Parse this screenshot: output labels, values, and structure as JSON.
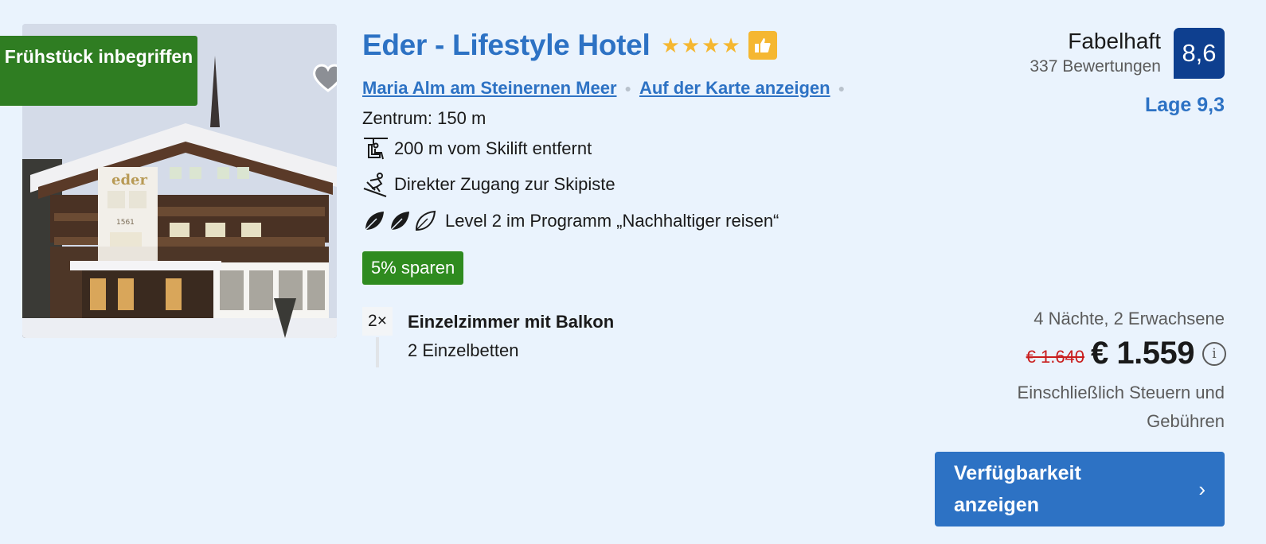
{
  "photo": {
    "breakfast_badge": "Frühstück inbegriffen",
    "favorite_icon": "heart-icon",
    "sign_text": "eder",
    "year_text": "1561"
  },
  "hotel": {
    "name": "Eder - Lifestyle Hotel",
    "stars": 4,
    "thumb_icon": "thumbs-up-icon",
    "location_link": "Maria Alm am Steinernen Meer",
    "map_link": "Auf der Karte anzeigen",
    "center_distance": "Zentrum: 150 m",
    "skilift": "200 m vom Skilift entfernt",
    "ski_access": "Direkter Zugang zur Skipiste",
    "sustainability": "Level 2 im Programm „Nachhaltiger reisen“",
    "sustainability_level": 2,
    "deal_badge": "5% sparen"
  },
  "room": {
    "quantity": "2×",
    "name": "Einzelzimmer mit Balkon",
    "beds": "2 Einzelbetten"
  },
  "rating": {
    "word": "Fabelhaft",
    "count": "337 Bewertungen",
    "score": "8,6",
    "location": "Lage 9,3"
  },
  "price": {
    "stay": "4 Nächte, 2 Erwachsene",
    "old": "€ 1.640",
    "new": "€ 1.559",
    "info_icon": "info-icon",
    "tax_note": "Einschließlich Steuern und Gebühren"
  },
  "cta": {
    "label": "Verfügbarkeit anzeigen",
    "icon": "chevron-right-icon"
  },
  "colors": {
    "brand_blue": "#2d72c4",
    "score_blue": "#0e3f8f",
    "green": "#2f7d22",
    "star_yellow": "#f5b731",
    "old_price_red": "#c91d1d",
    "background": "#eaf3fd"
  }
}
